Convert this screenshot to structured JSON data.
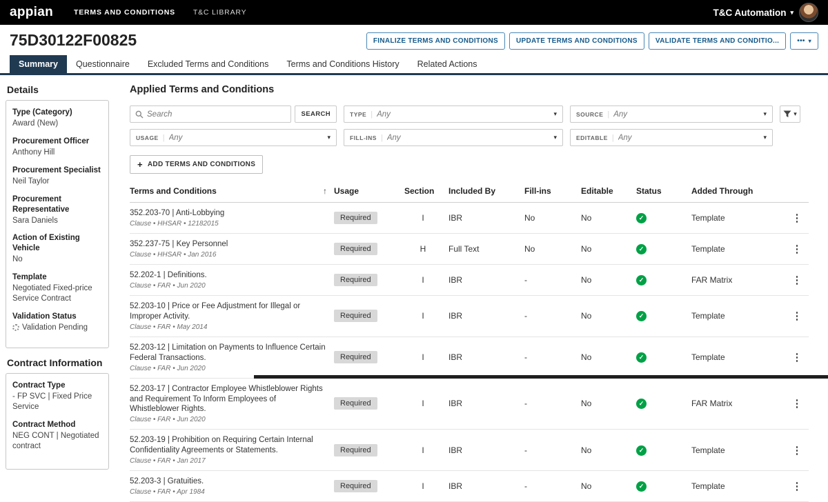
{
  "topnav": {
    "brand": "appian",
    "items": [
      {
        "label": "TERMS AND CONDITIONS",
        "active": true
      },
      {
        "label": "T&C LIBRARY",
        "active": false
      }
    ],
    "user_menu_label": "T&C Automation"
  },
  "header": {
    "title": "75D30122F00825",
    "buttons": [
      {
        "label": "FINALIZE TERMS AND CONDITIONS"
      },
      {
        "label": "UPDATE TERMS AND CONDITIONS"
      },
      {
        "label": "VALIDATE TERMS AND CONDITIO..."
      }
    ],
    "more_button_label": "•••"
  },
  "tabs": [
    {
      "label": "Summary",
      "active": true
    },
    {
      "label": "Questionnaire",
      "active": false
    },
    {
      "label": "Excluded Terms and Conditions",
      "active": false
    },
    {
      "label": "Terms and Conditions History",
      "active": false
    },
    {
      "label": "Related Actions",
      "active": false
    }
  ],
  "details": {
    "heading": "Details",
    "fields": [
      {
        "label": "Type (Category)",
        "value": "Award (New)"
      },
      {
        "label": "Procurement Officer",
        "value": "Anthony Hill"
      },
      {
        "label": "Procurement Specialist",
        "value": "Neil Taylor"
      },
      {
        "label": "Procurement Representative",
        "value": "Sara Daniels"
      },
      {
        "label": "Action of Existing Vehicle",
        "value": "No"
      },
      {
        "label": "Template",
        "value": "Negotiated Fixed-price Service Contract"
      },
      {
        "label": "Validation Status",
        "value": "Validation Pending",
        "pending": true
      }
    ]
  },
  "contract_info": {
    "heading": "Contract Information",
    "fields": [
      {
        "label": "Contract Type",
        "value": "- FP SVC | Fixed Price Service"
      },
      {
        "label": "Contract Method",
        "value": "NEG CONT | Negotiated contract"
      }
    ]
  },
  "main": {
    "heading": "Applied Terms and Conditions",
    "search": {
      "placeholder": "Search",
      "button_label": "SEARCH"
    },
    "filters": [
      {
        "label": "TYPE",
        "value": "Any"
      },
      {
        "label": "SOURCE",
        "value": "Any"
      },
      {
        "label": "USAGE",
        "value": "Any"
      },
      {
        "label": "FILL-INS",
        "value": "Any"
      },
      {
        "label": "EDITABLE",
        "value": "Any"
      }
    ],
    "add_button_label": "ADD TERMS AND CONDITIONS",
    "table": {
      "columns": [
        "Terms and Conditions",
        "Usage",
        "Section",
        "Included By",
        "Fill-ins",
        "Editable",
        "Status",
        "Added Through"
      ],
      "rows": [
        {
          "title": "352.203-70 | Anti-Lobbying",
          "subtitle": "Clause • HHSAR • 12182015",
          "usage": "Required",
          "section": "I",
          "included_by": "IBR",
          "fill_ins": "No",
          "editable": "No",
          "status": "valid",
          "added_through": "Template"
        },
        {
          "title": "352.237-75 | Key Personnel",
          "subtitle": "Clause • HHSAR • Jan 2016",
          "usage": "Required",
          "section": "H",
          "included_by": "Full Text",
          "fill_ins": "No",
          "editable": "No",
          "status": "valid",
          "added_through": "Template"
        },
        {
          "title": "52.202-1 | Definitions.",
          "subtitle": "Clause • FAR • Jun 2020",
          "usage": "Required",
          "section": "I",
          "included_by": "IBR",
          "fill_ins": "-",
          "editable": "No",
          "status": "valid",
          "added_through": "FAR Matrix"
        },
        {
          "title": "52.203-10 | Price or Fee Adjustment for Illegal or Improper Activity.",
          "subtitle": "Clause • FAR • May 2014",
          "usage": "Required",
          "section": "I",
          "included_by": "IBR",
          "fill_ins": "-",
          "editable": "No",
          "status": "valid",
          "added_through": "Template"
        },
        {
          "title": "52.203-12 | Limitation on Payments to Influence Certain Federal Transactions.",
          "subtitle": "Clause • FAR • Jun 2020",
          "usage": "Required",
          "section": "I",
          "included_by": "IBR",
          "fill_ins": "-",
          "editable": "No",
          "status": "valid",
          "added_through": "Template"
        },
        {
          "title": "52.203-17 | Contractor Employee Whistleblower Rights and Requirement To Inform Employees of Whistleblower Rights.",
          "subtitle": "Clause • FAR • Jun 2020",
          "usage": "Required",
          "section": "I",
          "included_by": "IBR",
          "fill_ins": "-",
          "editable": "No",
          "status": "valid",
          "added_through": "FAR Matrix"
        },
        {
          "title": "52.203-19 | Prohibition on Requiring Certain Internal Confidentiality Agreements or Statements.",
          "subtitle": "Clause • FAR • Jan 2017",
          "usage": "Required",
          "section": "I",
          "included_by": "IBR",
          "fill_ins": "-",
          "editable": "No",
          "status": "valid",
          "added_through": "Template"
        },
        {
          "title": "52.203-3 | Gratuities.",
          "subtitle": "Clause • FAR • Apr 1984",
          "usage": "Required",
          "section": "I",
          "included_by": "IBR",
          "fill_ins": "-",
          "editable": "No",
          "status": "valid",
          "added_through": "Template"
        }
      ]
    }
  },
  "icons": {
    "chevron_down": "▾",
    "sort_asc": "↑",
    "more_vertical": "⋮",
    "check": "✓",
    "plus": "+"
  }
}
